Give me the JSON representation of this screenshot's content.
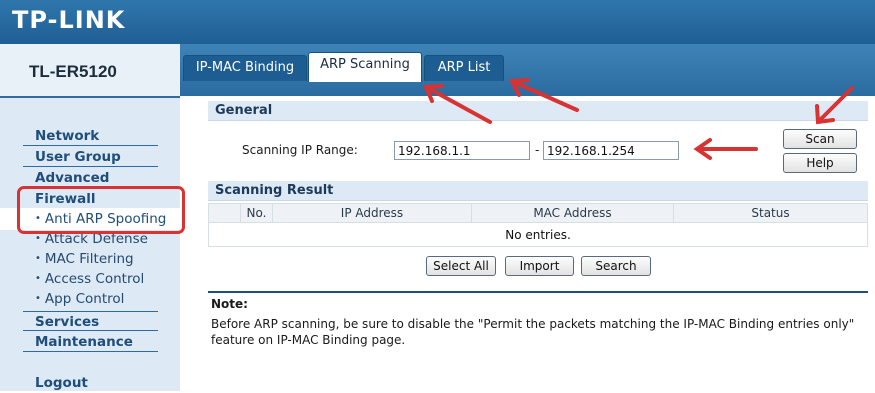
{
  "brand": {
    "logo": "TP-LINK",
    "model": "TL-ER5120"
  },
  "nav": {
    "network": "Network",
    "user_group": "User Group",
    "advanced": "Advanced",
    "firewall": "Firewall",
    "firewall_items": [
      "Anti ARP Spoofing",
      "Attack Defense",
      "MAC Filtering",
      "Access Control",
      "App Control"
    ],
    "services": "Services",
    "maintenance": "Maintenance",
    "logout": "Logout",
    "active_item": "Anti ARP Spoofing"
  },
  "tabs": [
    {
      "label": "IP-MAC Binding",
      "active": false
    },
    {
      "label": "ARP Scanning",
      "active": true
    },
    {
      "label": "ARP List",
      "active": false
    }
  ],
  "general": {
    "title": "General",
    "range_label": "Scanning IP Range:",
    "ip_start": "192.168.1.1",
    "separator": "-",
    "ip_end": "192.168.1.254",
    "scan_label": "Scan",
    "help_label": "Help"
  },
  "result": {
    "title": "Scanning Result",
    "columns": [
      "No.",
      "IP Address",
      "MAC Address",
      "Status"
    ],
    "empty_text": "No entries.",
    "buttons": {
      "select_all": "Select All",
      "import": "Import",
      "search": "Search"
    }
  },
  "note": {
    "title": "Note:",
    "text": "Before ARP scanning, be sure to disable the \"Permit the packets matching the IP-MAC Binding entries only\" feature on IP-MAC Binding page."
  },
  "colors": {
    "header_blue": "#1f5f93",
    "annotation_red": "#d83232",
    "section_bg": "#dde9f5"
  }
}
